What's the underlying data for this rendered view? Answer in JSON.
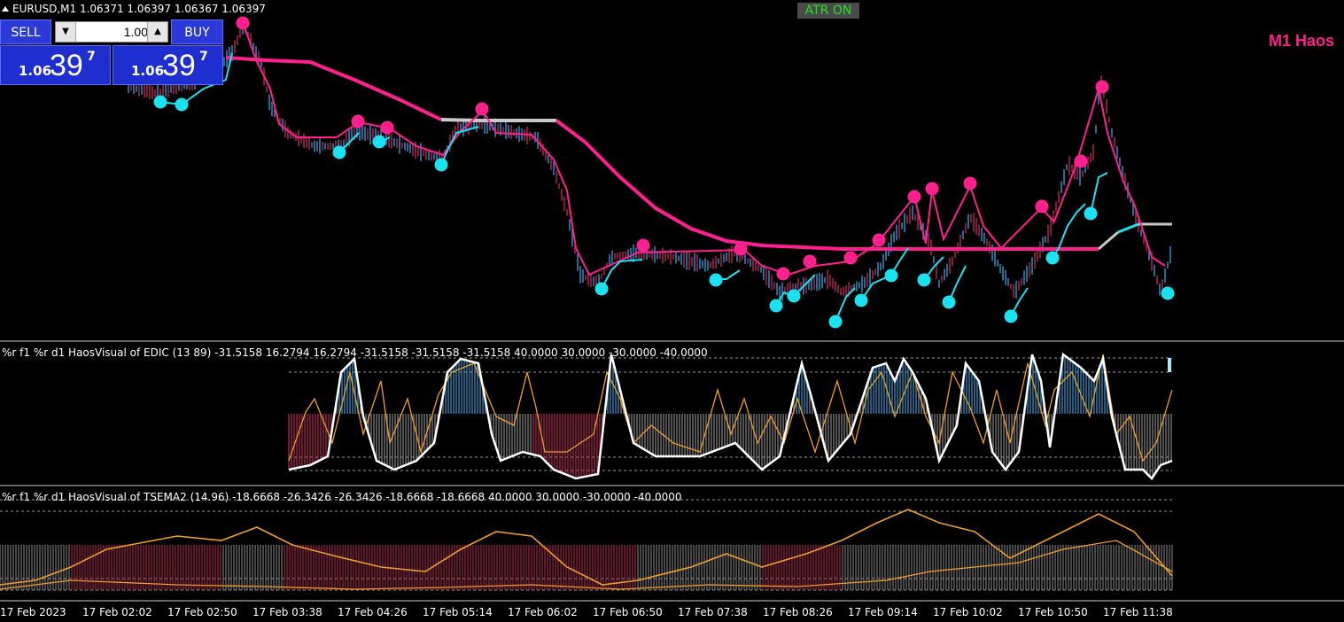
{
  "header": {
    "symbol_line": "EURUSD,M1  1.06371 1.06397 1.06367 1.06397"
  },
  "atr_badge": {
    "label": "ATR ON"
  },
  "brand_title": "M1 Haos",
  "trade_panel": {
    "sell_label": "SELL",
    "buy_label": "BUY",
    "lot_value": "1.00",
    "sell_price": {
      "prefix": "1.06",
      "big": "39",
      "sup": "7"
    },
    "buy_price": {
      "prefix": "1.06",
      "big": "39",
      "sup": "7"
    }
  },
  "indicators": [
    {
      "label": "%r f1 %r d1 HaosVisual of EDIC (13 89) -31.5158 16.2794 16.2794 -31.5158 -31.5158 -31.5158 40.0000 30.0000 -30.0000 -40.0000"
    },
    {
      "label": "%r f1 %r d1 HaosVisual of TSEMA2 (14.96) -18.6668 -26.3426 -26.3426 -18.6668 -18.6668 40.0000 30.0000 -30.0000 -40.0000"
    }
  ],
  "time_axis": [
    "17 Feb 2023",
    "17 Feb 02:02",
    "17 Feb 02:50",
    "17 Feb 03:38",
    "17 Feb 04:26",
    "17 Feb 05:14",
    "17 Feb 06:02",
    "17 Feb 06:50",
    "17 Feb 07:38",
    "17 Feb 08:26",
    "17 Feb 09:14",
    "17 Feb 10:02",
    "17 Feb 10:50",
    "17 Feb 11:38"
  ],
  "colors": {
    "background": "#000000",
    "pink": "#ff1f8f",
    "cyan": "#19e3f0",
    "silver": "#c8c8c8",
    "orange": "#f0a020",
    "bull_bar": "#3a9cd8",
    "bear_bar": "#c02a5a",
    "neutral_bar": "#8a8a8a",
    "panel_blue": "#2a39d8"
  }
}
